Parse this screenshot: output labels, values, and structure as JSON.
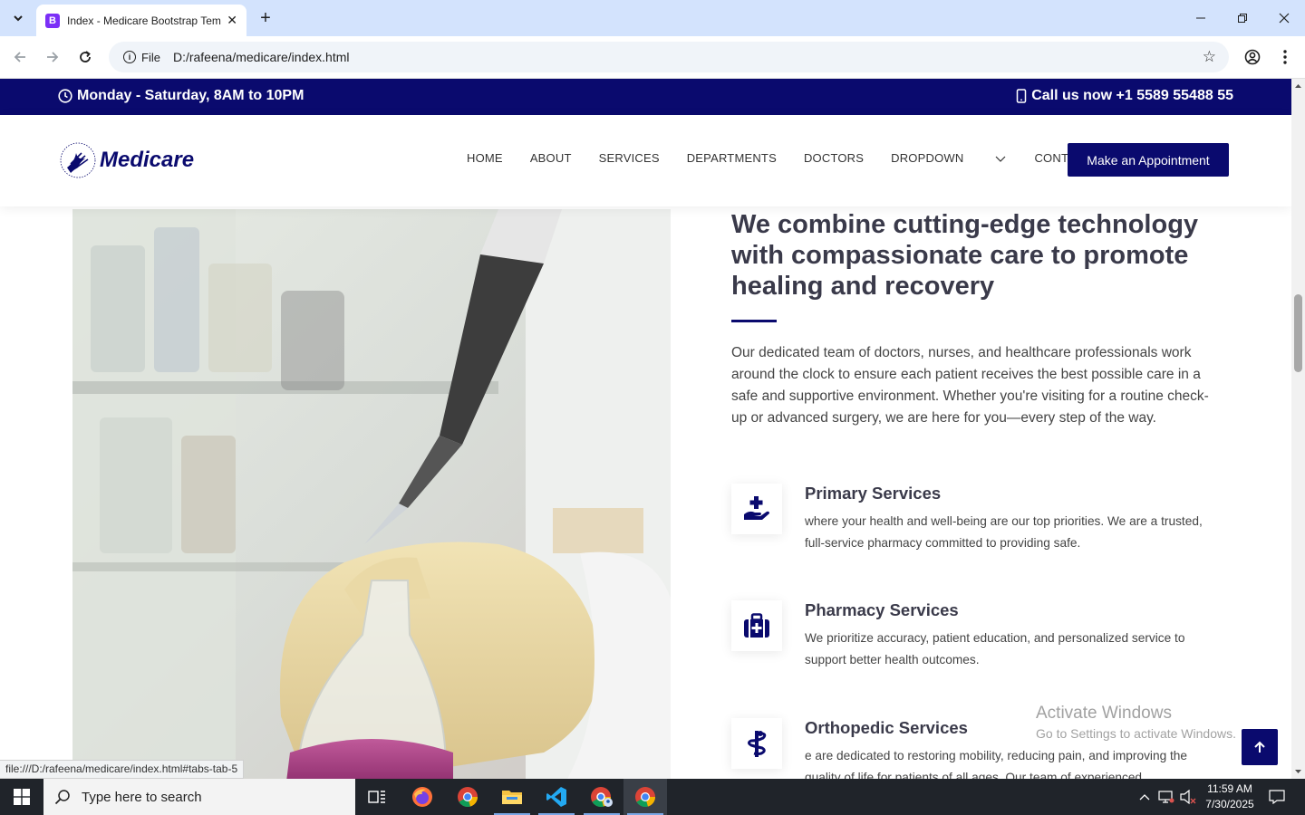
{
  "browser": {
    "tab_title": "Index - Medicare Bootstrap Template",
    "favicon_letter": "B",
    "address_chip": "File",
    "url": "D:/rafeena/medicare/index.html"
  },
  "topbar": {
    "hours": "Monday - Saturday, 8AM to 10PM",
    "phone": "Call us now +1 5589 55488 55"
  },
  "header": {
    "logo_text": "Medicare",
    "menu": [
      "HOME",
      "ABOUT",
      "SERVICES",
      "DEPARTMENTS",
      "DOCTORS",
      "DROPDOWN",
      "CONTACT"
    ],
    "cta": "Make an Appointment"
  },
  "about": {
    "headline": "We combine cutting-edge technology with compassionate care to promote healing and recovery",
    "intro": "Our dedicated team of doctors, nurses, and healthcare professionals work around the clock to ensure each patient receives the best possible care in a safe and supportive environment. Whether you're visiting for a routine check-up or advanced surgery, we are here for you—every step of the way."
  },
  "services": [
    {
      "title": "Primary Services",
      "desc": "where your health and well-being are our top priorities. We are a trusted, full-service pharmacy committed to providing safe.",
      "icon": "hand-holding-medical-icon"
    },
    {
      "title": "Pharmacy Services",
      "desc": "We prioritize accuracy, patient education, and personalized service to support better health outcomes.",
      "icon": "medical-kit-icon"
    },
    {
      "title": "Orthopedic Services",
      "desc": "e are dedicated to restoring mobility, reducing pain, and improving the quality of life for patients of all ages. Our team of experienced",
      "icon": "staff-snake-icon"
    }
  ],
  "status_bar_url": "file:///D:/rafeena/medicare/index.html#tabs-tab-5",
  "watermark": {
    "line1": "Activate Windows",
    "line2": "Go to Settings to activate Windows."
  },
  "taskbar": {
    "search_placeholder": "Type here to search",
    "time": "11:59 AM",
    "date": "7/30/2025"
  },
  "colors": {
    "brand_navy": "#0a0a6e",
    "chrome_tabstrip": "#d3e3fd",
    "taskbar": "#20242a"
  }
}
